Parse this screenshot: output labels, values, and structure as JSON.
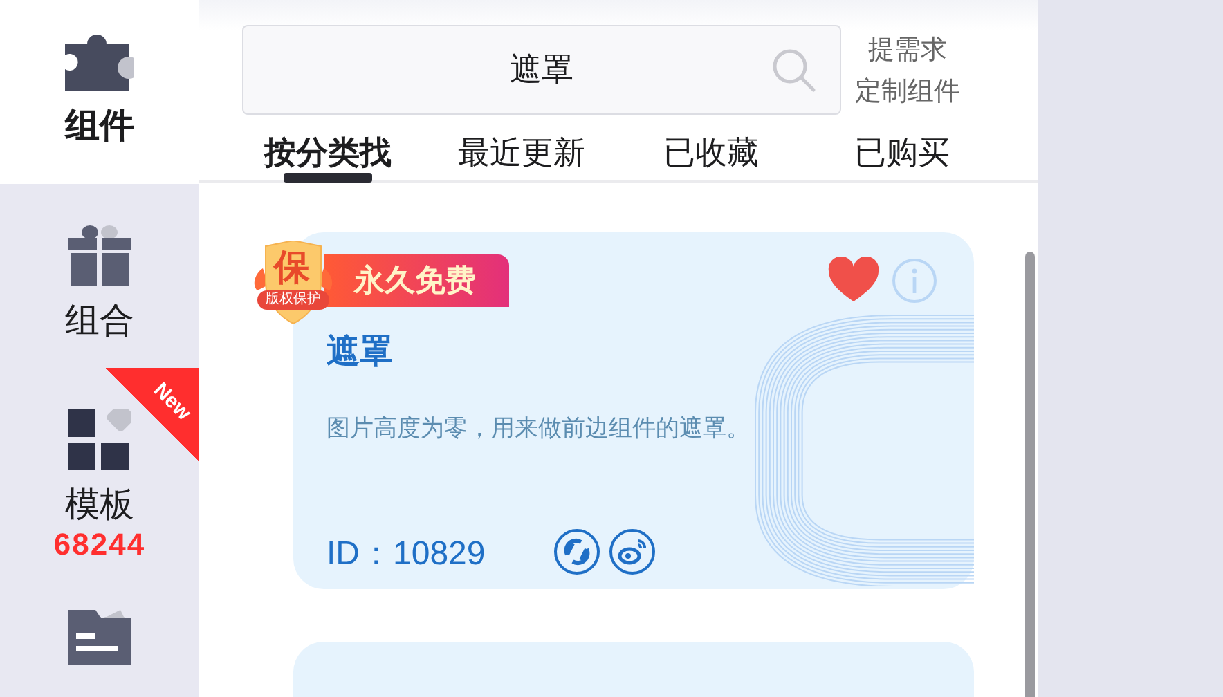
{
  "sidebar": {
    "items": [
      {
        "label": "组件",
        "selected": true
      },
      {
        "label": "组合",
        "selected": false
      },
      {
        "label": "模板",
        "selected": false,
        "count": "68244",
        "badge": "New"
      },
      {
        "selected": false
      }
    ]
  },
  "search": {
    "value": "遮罩"
  },
  "request_link": {
    "lines": [
      "提需求",
      "定制组件"
    ]
  },
  "tabs": [
    {
      "label": "按分类找",
      "selected": true
    },
    {
      "label": "最近更新",
      "selected": false
    },
    {
      "label": "已收藏",
      "selected": false
    },
    {
      "label": "已购买",
      "selected": false
    }
  ],
  "cards": [
    {
      "kind": "full",
      "shield": "保",
      "shield_ribbon": "版权保护",
      "tag": "永久免费",
      "favorited": true,
      "title": "遮罩",
      "description": "图片高度为零，用来做前边组件的遮罩。",
      "id": "ID：10829"
    },
    {
      "kind": "peek"
    }
  ]
}
